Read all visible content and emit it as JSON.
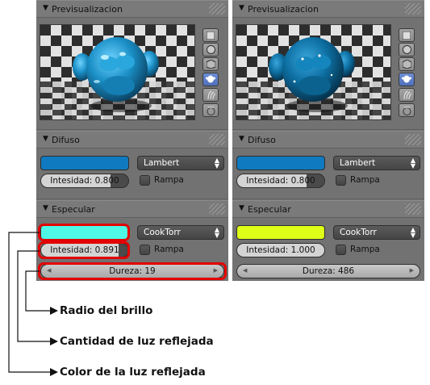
{
  "panels": [
    {
      "preview": {
        "title": "Previsualizacion"
      },
      "difuso": {
        "title": "Difuso",
        "color": "#0f7abf",
        "shader": "Lambert",
        "intensity_text": "Intesidad: 0.800",
        "intensity": 0.8,
        "ramp_label": "Rampa"
      },
      "especular": {
        "title": "Especular",
        "color": "#4ef7e6",
        "shader": "CookTorr",
        "intensity_text": "Intesidad: 0.891",
        "intensity": 0.891,
        "ramp_label": "Rampa",
        "hardness_text": "Dureza: 19"
      }
    },
    {
      "preview": {
        "title": "Previsualizacion"
      },
      "difuso": {
        "title": "Difuso",
        "color": "#0f7abf",
        "shader": "Lambert",
        "intensity_text": "Intesidad: 0.800",
        "intensity": 0.8,
        "ramp_label": "Rampa"
      },
      "especular": {
        "title": "Especular",
        "color": "#deff17",
        "shader": "CookTorr",
        "intensity_text": "Intesidad: 1.000",
        "intensity": 1.0,
        "ramp_label": "Rampa",
        "hardness_text": "Dureza: 486"
      }
    }
  ],
  "annotations": [
    "Radio del brillo",
    "Cantidad de luz reflejada",
    "Color de la luz reflejada"
  ],
  "colors": {
    "highlight": "#e30000",
    "panel_bg": "#727272",
    "active_tab": "#5a7cc9"
  }
}
